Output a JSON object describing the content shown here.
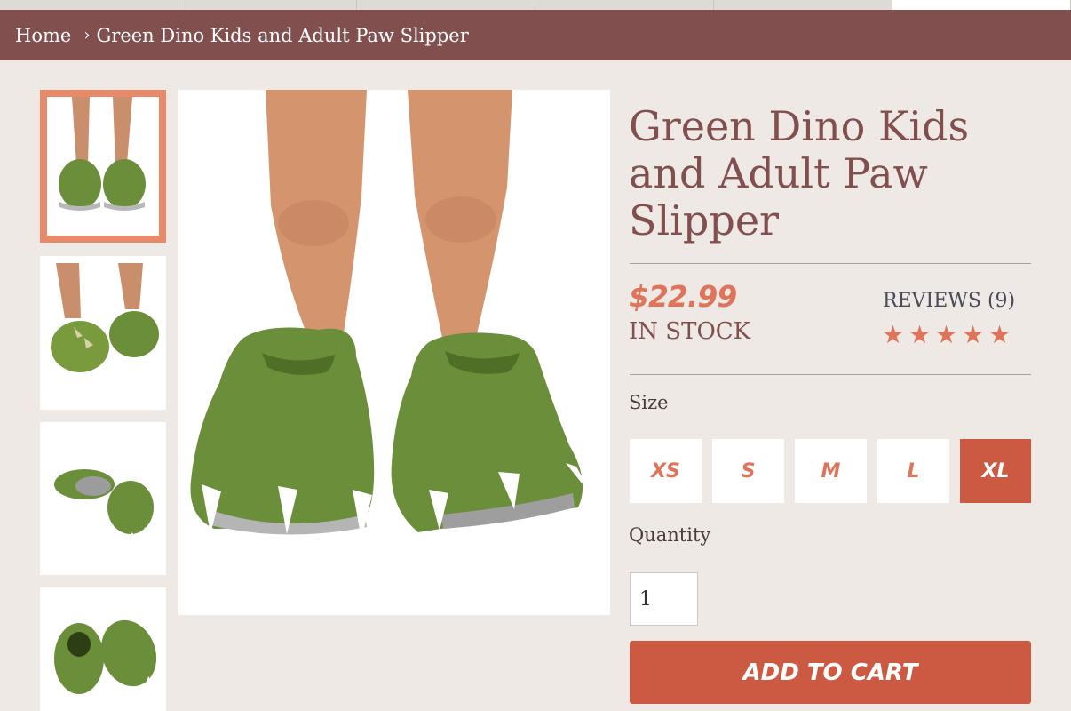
{
  "breadcrumb": {
    "home": "Home",
    "separator": "›",
    "current": "Green Dino Kids and Adult Paw Slipper"
  },
  "gallery": {
    "thumbnails": [
      {
        "alt": "front view on legs",
        "selected": true
      },
      {
        "alt": "side view on legs",
        "selected": false
      },
      {
        "alt": "pair lying on side",
        "selected": false
      },
      {
        "alt": "pair top view",
        "selected": false
      }
    ],
    "main_image_alt": "green dino paw slippers worn on legs"
  },
  "product": {
    "title": "Green Dino Kids and Adult Paw Slipper",
    "price": "$22.99",
    "stock": "IN STOCK",
    "reviews_label": "REVIEWS (9)",
    "rating": 5,
    "rating_max": 5,
    "star_icon": "star-icon"
  },
  "options": {
    "size_label": "Size",
    "sizes": [
      "XS",
      "S",
      "M",
      "L",
      "XL"
    ],
    "selected_size": "XL",
    "quantity_label": "Quantity",
    "quantity": "1"
  },
  "actions": {
    "add_to_cart": "ADD TO CART"
  },
  "colors": {
    "breadcrumb_bg": "#824f4f",
    "accent": "#e0745a",
    "button": "#cc5a42",
    "page_bg": "#eee9e4",
    "slipper_green": "#6b8e3a"
  }
}
